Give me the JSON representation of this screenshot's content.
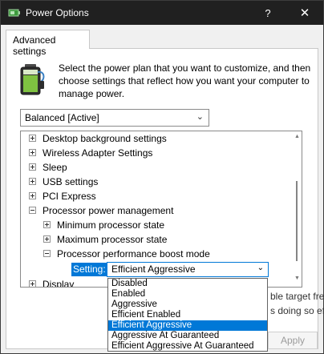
{
  "window": {
    "title": "Power Options"
  },
  "titlebar": {
    "help_label": "?",
    "close_label": "✕"
  },
  "tab": {
    "label": "Advanced settings"
  },
  "description": "Select the power plan that you want to customize, and then choose settings that reflect how you want your computer to manage power.",
  "plan_select": {
    "value": "Balanced [Active]"
  },
  "tree": {
    "items": [
      {
        "label": "Desktop background settings",
        "expander": "+"
      },
      {
        "label": "Wireless Adapter Settings",
        "expander": "+"
      },
      {
        "label": "Sleep",
        "expander": "+"
      },
      {
        "label": "USB settings",
        "expander": "+"
      },
      {
        "label": "PCI Express",
        "expander": "+"
      },
      {
        "label": "Processor power management",
        "expander": "-"
      },
      {
        "label": "Minimum processor state",
        "expander": "+"
      },
      {
        "label": "Maximum processor state",
        "expander": "+"
      },
      {
        "label": "Processor performance boost mode",
        "expander": "-"
      },
      {
        "label": "Display",
        "expander": "+"
      }
    ],
    "setting_label": "Setting:",
    "setting_value": "Efficient Aggressive"
  },
  "dropdown": {
    "options": [
      "Disabled",
      "Enabled",
      "Aggressive",
      "Efficient Enabled",
      "Efficient Aggressive",
      "Aggressive At Guaranteed",
      "Efficient Aggressive At Guaranteed"
    ],
    "selected": "Efficient Aggressive"
  },
  "background_text": {
    "line1": "ble target fre",
    "line2": "s doing so eff"
  },
  "buttons": {
    "apply": "Apply"
  }
}
